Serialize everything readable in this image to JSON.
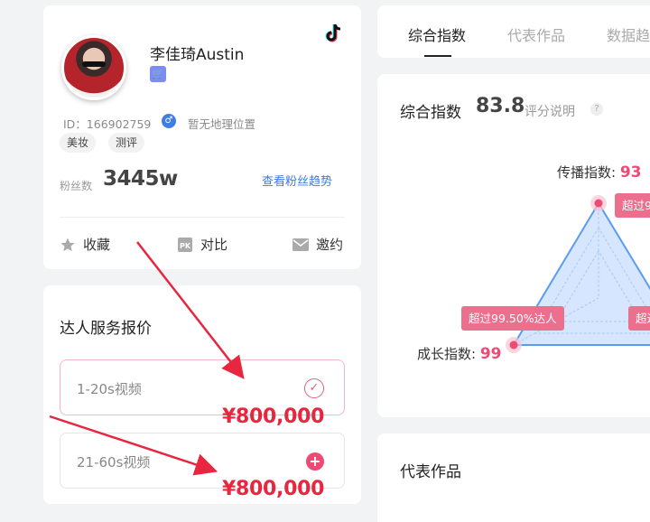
{
  "profile": {
    "name": "李佳琦Austin",
    "id_label": "ID：166902759",
    "gender_symbol": "♂",
    "location": "暂无地理位置",
    "tags": [
      "美妆",
      "测评"
    ],
    "fans_label": "粉丝数",
    "fans_value": "3445w",
    "fans_trend_link": "查看粉丝趋势",
    "actions": [
      {
        "label": "收藏",
        "icon": "star-icon"
      },
      {
        "label": "对比",
        "icon": "pk-icon"
      },
      {
        "label": "邀约",
        "icon": "mail-icon"
      }
    ],
    "platform_icon": "tiktok-icon",
    "shop_icon": "cart-icon"
  },
  "pricing": {
    "title": "达人服务报价",
    "options": [
      {
        "label": "1-20s视频",
        "state": "selected"
      },
      {
        "label": "21-60s视频",
        "state": "add"
      }
    ],
    "prices": [
      "¥800,000",
      "¥800,000"
    ]
  },
  "tabs": {
    "items": [
      "综合指数",
      "代表作品",
      "数据趋"
    ],
    "active": "综合指数"
  },
  "index": {
    "title": "综合指数",
    "score": "83.8",
    "help_label": "评分说明",
    "help_icon": "?",
    "axes": [
      {
        "label": "传播指数:",
        "value": "93"
      },
      {
        "label": "成长指数:",
        "value": "99"
      }
    ],
    "bubbles": [
      "超过9",
      "超过99.50%达人",
      "超过"
    ]
  },
  "works": {
    "title": "代表作品"
  },
  "colors": {
    "accent_pink": "#ee4b74",
    "link_blue": "#3d7ae6",
    "price_red": "#e8263f",
    "radar_fill": "#cfe2ff",
    "radar_stroke": "#5b9bf0"
  }
}
